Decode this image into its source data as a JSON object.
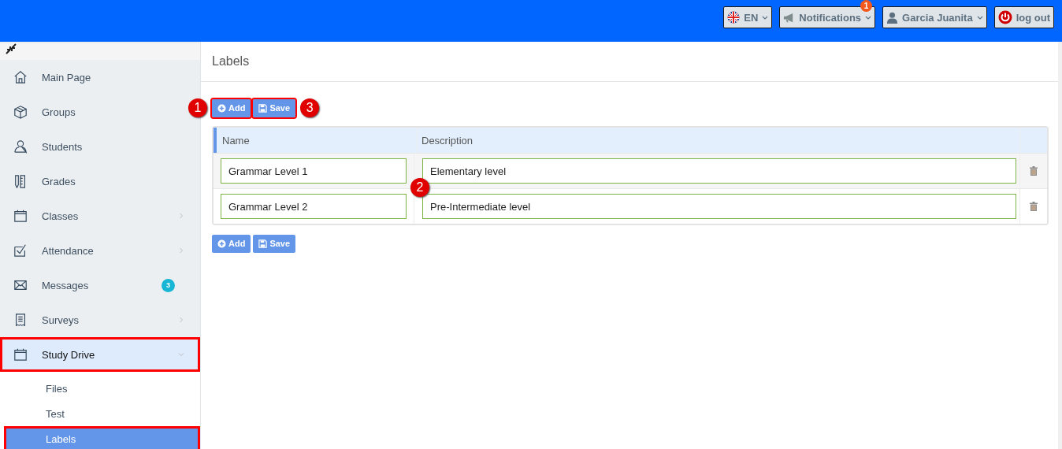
{
  "header": {
    "language": {
      "label": "EN"
    },
    "notifications": {
      "label": "Notifications",
      "badge": "1"
    },
    "user": {
      "label": "Garcia Juanita"
    },
    "logout": {
      "label": "log out"
    }
  },
  "sidebar": {
    "items": [
      {
        "label": "Main Page",
        "expandable": false,
        "expanded": false,
        "highlighted": false
      },
      {
        "label": "Groups",
        "expandable": false,
        "expanded": false,
        "highlighted": false
      },
      {
        "label": "Students",
        "expandable": false,
        "expanded": false,
        "highlighted": false
      },
      {
        "label": "Grades",
        "expandable": false,
        "expanded": false,
        "highlighted": false
      },
      {
        "label": "Classes",
        "expandable": true,
        "expanded": false,
        "highlighted": false
      },
      {
        "label": "Attendance",
        "expandable": true,
        "expanded": false,
        "highlighted": false
      },
      {
        "label": "Messages",
        "expandable": false,
        "expanded": false,
        "highlighted": false,
        "badge": "3"
      },
      {
        "label": "Surveys",
        "expandable": true,
        "expanded": false,
        "highlighted": false
      },
      {
        "label": "Study Drive",
        "expandable": true,
        "expanded": true,
        "highlighted": true,
        "children": [
          {
            "label": "Files",
            "selected": false,
            "highlighted": false
          },
          {
            "label": "Test",
            "selected": false,
            "highlighted": false
          },
          {
            "label": "Labels",
            "selected": true,
            "highlighted": true
          }
        ]
      }
    ]
  },
  "page": {
    "title": "Labels",
    "top_toolbar": [
      {
        "kind": "add",
        "label": "Add",
        "highlighted": true,
        "callout": "1"
      },
      {
        "kind": "save",
        "label": "Save",
        "highlighted": true,
        "callout": "3"
      }
    ],
    "table": {
      "columns": [
        "Name",
        "Description"
      ],
      "callout": "2",
      "rows": [
        {
          "name": "Grammar Level 1",
          "description": "Elementary level"
        },
        {
          "name": "Grammar Level 2",
          "description": "Pre-Intermediate level"
        }
      ]
    },
    "bottom_toolbar": [
      {
        "kind": "add",
        "label": "Add",
        "highlighted": false
      },
      {
        "kind": "save",
        "label": "Save",
        "highlighted": false
      }
    ]
  }
}
